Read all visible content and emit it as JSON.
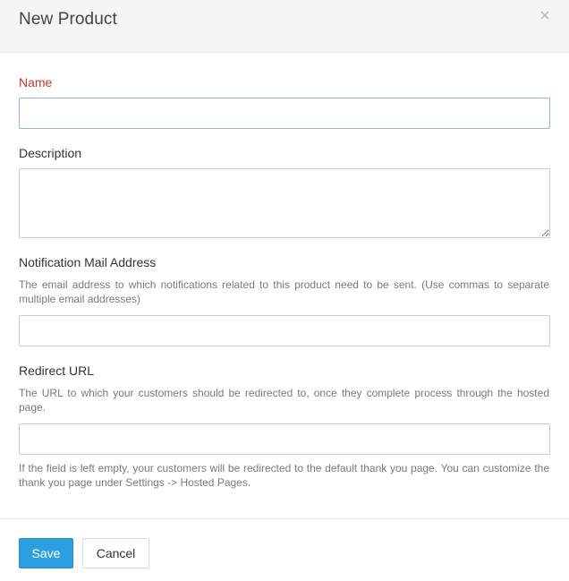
{
  "modal": {
    "title": "New Product"
  },
  "form": {
    "name": {
      "label": "Name",
      "value": "",
      "placeholder": ""
    },
    "description": {
      "label": "Description",
      "value": "",
      "placeholder": ""
    },
    "notification_mail": {
      "label": "Notification Mail Address",
      "help": "The email address to which notifications related to this product need to be sent. (Use commas to separate multiple email addresses)",
      "value": "",
      "placeholder": ""
    },
    "redirect_url": {
      "label": "Redirect URL",
      "help": "The URL to which your customers should be redirected to, once they complete process through the hosted page.",
      "value": "",
      "placeholder": "",
      "note": "If the field is left empty, your customers will be redirected to the default thank you page. You can customize the thank you page under Settings -> Hosted Pages."
    }
  },
  "footer": {
    "save_label": "Save",
    "cancel_label": "Cancel"
  },
  "icons": {
    "close": "close-icon"
  },
  "colors": {
    "required_label": "#c0392b",
    "primary_button": "#2d9ee0",
    "focused_border": "#8fb5dd"
  }
}
